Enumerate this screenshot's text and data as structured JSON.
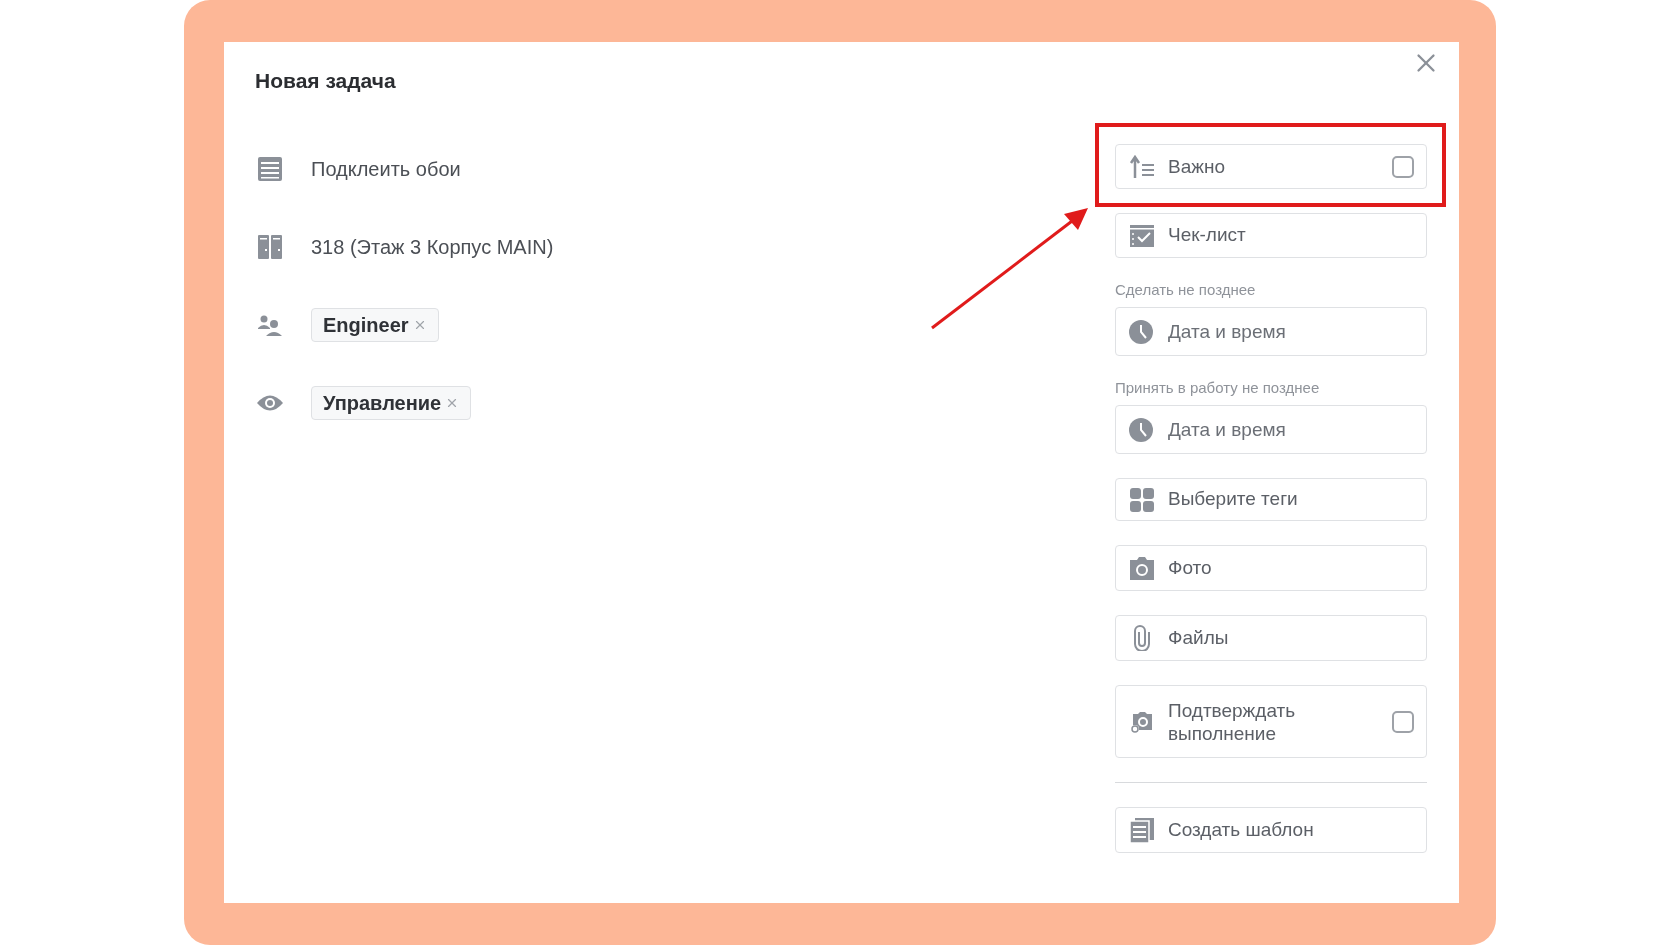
{
  "dialog": {
    "title": "Новая задача"
  },
  "details": [
    {
      "kind": "text",
      "text": "Подклеить обои"
    },
    {
      "kind": "text",
      "text": "318 (Этаж 3 Корпус MAIN)"
    },
    {
      "kind": "chips",
      "chips": [
        {
          "label": "Engineer"
        }
      ]
    },
    {
      "kind": "chips",
      "chips": [
        {
          "label": "Управление"
        }
      ]
    }
  ],
  "options": [
    {
      "kind": "checkbox",
      "label": "Важно",
      "checked": false,
      "highlighted": true
    },
    {
      "kind": "button",
      "label": "Чек-лист"
    },
    {
      "kind": "date",
      "caption": "Сделать не позднее",
      "placeholder": "Дата и время"
    },
    {
      "kind": "date",
      "caption": "Принять в работу не позднее",
      "placeholder": "Дата и время"
    },
    {
      "kind": "button",
      "label": "Выберите теги"
    },
    {
      "kind": "button",
      "label": "Фото"
    },
    {
      "kind": "button",
      "label": "Файлы"
    },
    {
      "kind": "checkbox",
      "label": "Подтверждать выполнение",
      "checked": false,
      "highlighted": false
    }
  ],
  "footer_button": {
    "label": "Создать шаблон"
  }
}
